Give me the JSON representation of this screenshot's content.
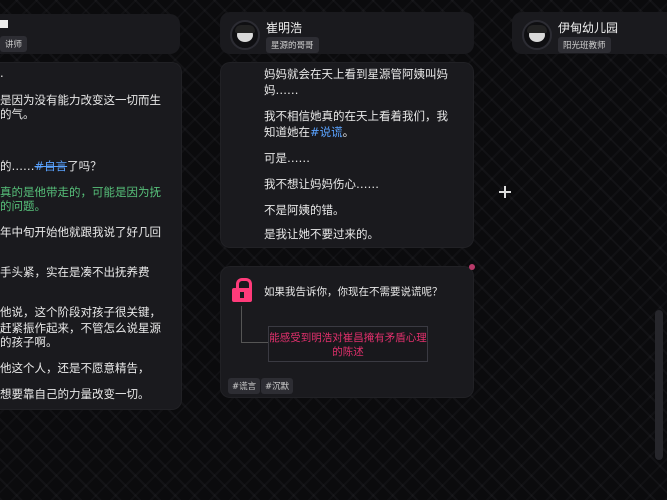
{
  "left_panel": {
    "header_tag": "讲师",
    "lines": [
      ".",
      "是因为没有能力改变这一切而生",
      "的气。",
      "的……#自言了吗？",
      "真的是他带走的，可能是因为抚",
      "的问题。",
      "年中旬开始他就跟我说了好几回",
      "手头紧，实在是凑不出抚养费",
      "他说，这个阶段对孩子很关键，",
      "赶紧振作起来，不管怎么说星源",
      "的孩子啊。",
      "他这个人，还是不愿意精告，",
      "想要靠自己的力量改变一切。"
    ]
  },
  "mid_header": {
    "name": "崔明浩",
    "tag": "星源的哥哥"
  },
  "right_header": {
    "name": "伊甸幼儿园",
    "tag": "阳光班教师"
  },
  "dialogue": {
    "lines": [
      "妈妈就会在天上看到星源管阿姨叫妈",
      "妈……",
      "我不相信她真的在天上看着我们，我",
      "知道她在",
      "#说谎",
      "。",
      "可是……",
      "我不想让妈妈伤心……",
      "不是阿姨的错。",
      "是我让她不要过来的。"
    ]
  },
  "prompt": {
    "question": "如果我告诉你，你现在不需要说谎呢？",
    "choice": "能感受到明浩对崔昌掩有矛盾心理的陈述",
    "tags": [
      "#谎言",
      "#沉默"
    ]
  },
  "colors": {
    "accent_pink": "#ff3b7a",
    "link_blue": "#5aa3ff",
    "green": "#57c07a"
  }
}
